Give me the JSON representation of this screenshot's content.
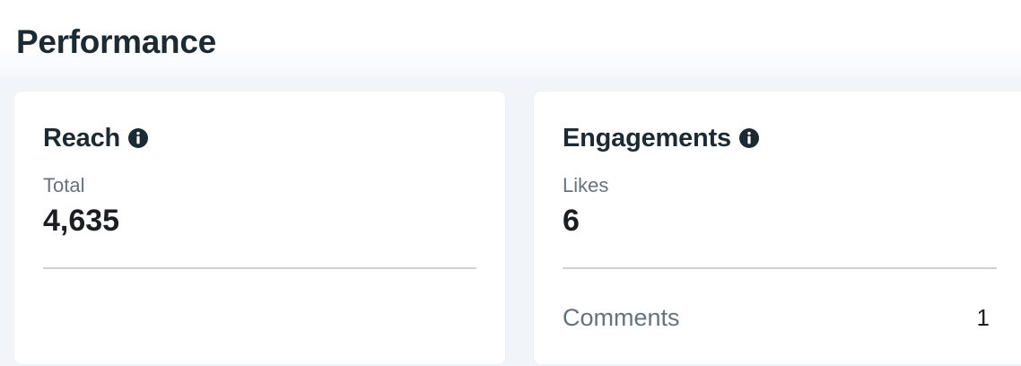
{
  "page": {
    "title": "Performance"
  },
  "reach": {
    "title": "Reach",
    "info_icon": "info-icon",
    "metric_label": "Total",
    "metric_value": "4,635"
  },
  "engagements": {
    "title": "Engagements",
    "info_icon": "info-icon",
    "metric_label": "Likes",
    "metric_value": "6",
    "breakdown": [
      {
        "label": "Comments",
        "value": "1"
      }
    ]
  },
  "colors": {
    "text_primary": "#1c2b33",
    "text_secondary": "#65737e",
    "card_background": "#ffffff",
    "page_background": "#f1f4f9",
    "divider": "#cfd3d8"
  }
}
